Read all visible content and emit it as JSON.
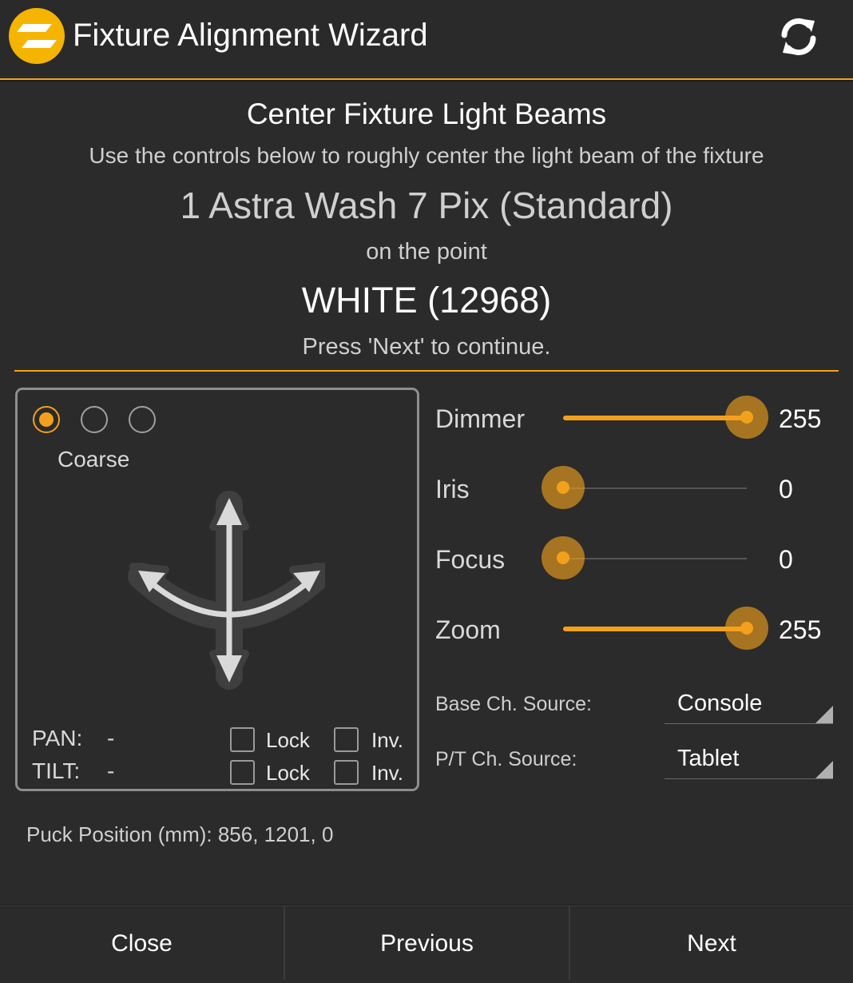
{
  "header": {
    "title": "Fixture Alignment Wizard",
    "logo_icon": "logo-icon",
    "refresh_icon": "refresh-icon",
    "accent_color": "#f3a11c"
  },
  "wizard": {
    "heading": "Center Fixture Light Beams",
    "instructions": "Use the controls below to roughly center the light beam of the fixture",
    "fixture_name": "1 Astra Wash 7 Pix (Standard)",
    "on_the_point": "on the point",
    "point_name": "WHITE (12968)",
    "press_next": "Press 'Next' to continue."
  },
  "pan_tilt": {
    "mode_selected_index": 0,
    "mode_label": "Coarse",
    "pan_label": "PAN:",
    "pan_value": "-",
    "tilt_label": "TILT:",
    "tilt_value": "-",
    "lock_label": "Lock",
    "invert_label": "Inv."
  },
  "sliders": [
    {
      "label": "Dimmer",
      "value": "255",
      "level": 1.0
    },
    {
      "label": "Iris",
      "value": "0",
      "level": 0.0
    },
    {
      "label": "Focus",
      "value": "0",
      "level": 0.0
    },
    {
      "label": "Zoom",
      "value": "255",
      "level": 1.0
    }
  ],
  "sources": {
    "base_label": "Base Ch. Source:",
    "base_value": "Console",
    "pt_label": "P/T Ch. Source:",
    "pt_value": "Tablet"
  },
  "puck_position": "Puck Position (mm): 856, 1201, 0",
  "footer": {
    "close": "Close",
    "previous": "Previous",
    "next": "Next"
  }
}
